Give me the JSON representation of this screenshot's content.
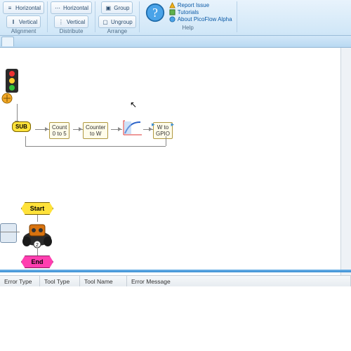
{
  "ribbon": {
    "alignment": {
      "label": "Alignment",
      "horizontal": "Horizontal",
      "vertical": "Vertical"
    },
    "distribute": {
      "label": "Distribute",
      "horizontal": "Horizontal",
      "vertical": "Vertical"
    },
    "arrange": {
      "label": "Arrange",
      "group": "Group",
      "ungroup": "Ungroup"
    },
    "help": {
      "label": "Help",
      "report": "Report Issue",
      "tutorials": "Tutorials",
      "about": "About PicoFlow Alpha"
    }
  },
  "canvas": {
    "nodes": {
      "sub": "SUB",
      "count": "Count\n0 to 5",
      "counter_to_w": "Counter\nto W",
      "w_to_gpio": "W to\nGPIO",
      "start": "Start",
      "end": "End"
    }
  },
  "errors": {
    "columns": [
      "Error Type",
      "Tool Type",
      "Tool Name",
      "Error Message"
    ]
  }
}
